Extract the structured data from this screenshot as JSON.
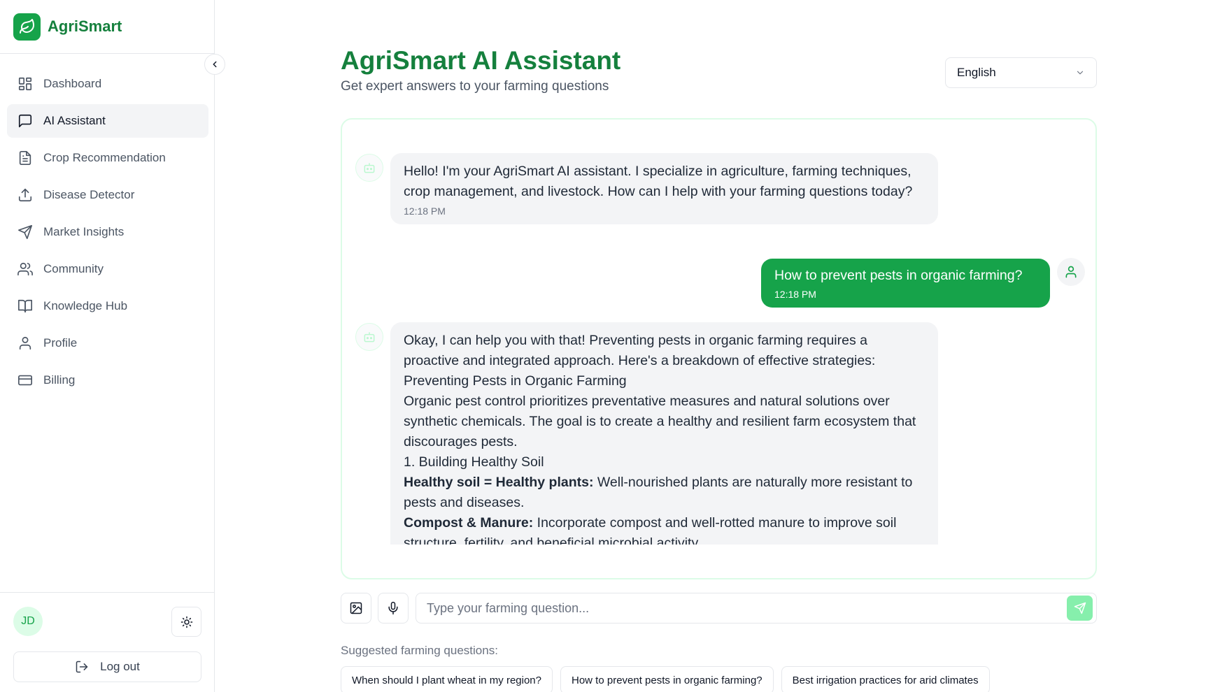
{
  "brand": {
    "name": "AgriSmart",
    "logo_icon": "leaf-icon",
    "color": "#16a34a"
  },
  "sidebar": {
    "items": [
      {
        "label": "Dashboard",
        "icon": "dashboard-icon",
        "active": false
      },
      {
        "label": "AI Assistant",
        "icon": "chat-icon",
        "active": true
      },
      {
        "label": "Crop Recommendation",
        "icon": "document-icon",
        "active": false
      },
      {
        "label": "Disease Detector",
        "icon": "upload-icon",
        "active": false
      },
      {
        "label": "Market Insights",
        "icon": "send-icon",
        "active": false
      },
      {
        "label": "Community",
        "icon": "users-icon",
        "active": false
      },
      {
        "label": "Knowledge Hub",
        "icon": "book-icon",
        "active": false
      },
      {
        "label": "Profile",
        "icon": "user-icon",
        "active": false
      },
      {
        "label": "Billing",
        "icon": "credit-card-icon",
        "active": false
      }
    ],
    "user_initials": "JD",
    "logout_label": "Log out"
  },
  "header": {
    "title": "AgriSmart AI Assistant",
    "subtitle": "Get expert answers to your farming questions",
    "language": "English"
  },
  "messages": [
    {
      "role": "assistant",
      "text": "Hello! I'm your AgriSmart AI assistant. I specialize in agriculture, farming techniques, crop management, and livestock. How can I help with your farming questions today?",
      "time": "12:18 PM"
    },
    {
      "role": "user",
      "text": "How to prevent pests in organic farming?",
      "time": "12:18 PM"
    },
    {
      "role": "assistant",
      "intro": "Okay, I can help you with that! Preventing pests in organic farming requires a proactive and integrated approach. Here's a breakdown of effective strategies:",
      "heading": "Preventing Pests in Organic Farming",
      "paragraph": "Organic pest control prioritizes preventative measures and natural solutions over synthetic chemicals. The goal is to create a healthy and resilient farm ecosystem that discourages pests.",
      "section": "1. Building Healthy Soil",
      "points": [
        {
          "bold": "Healthy soil = Healthy plants:",
          "text": " Well-nourished plants are naturally more resistant to pests and diseases."
        },
        {
          "bold": "Compost & Manure:",
          "text": " Incorporate compost and well-rotted manure to improve soil structure, fertility, and beneficial microbial activity."
        }
      ]
    }
  ],
  "input": {
    "placeholder": "Type your farming question..."
  },
  "suggestions": {
    "label": "Suggested farming questions:",
    "items": [
      "When should I plant wheat in my region?",
      "How to prevent pests in organic farming?",
      "Best irrigation practices for arid climates"
    ]
  }
}
